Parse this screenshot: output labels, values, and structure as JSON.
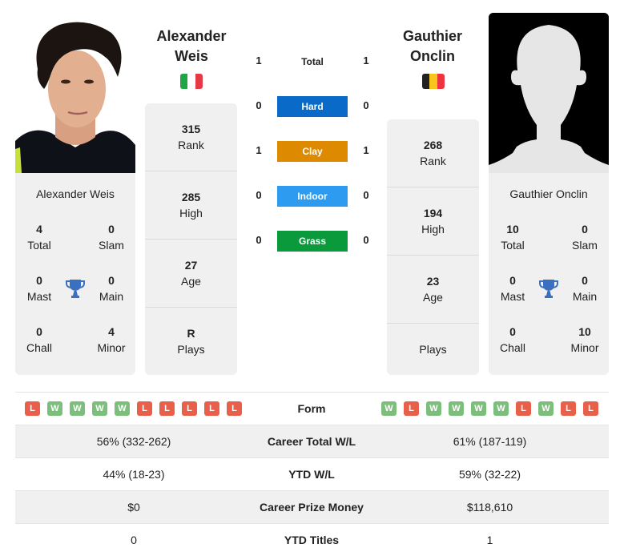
{
  "player1": {
    "name_line1": "Alexander",
    "name_line2": "Weis",
    "full_name": "Alexander Weis",
    "flag": {
      "country": "Italy",
      "colors": [
        "#1fa446",
        "#ffffff",
        "#e63946"
      ]
    },
    "titles": {
      "total": {
        "value": "4",
        "label": "Total"
      },
      "slam": {
        "value": "0",
        "label": "Slam"
      },
      "mast": {
        "value": "0",
        "label": "Mast"
      },
      "main": {
        "value": "0",
        "label": "Main"
      },
      "chall": {
        "value": "0",
        "label": "Chall"
      },
      "minor": {
        "value": "4",
        "label": "Minor"
      }
    },
    "rank": {
      "value": "315",
      "label": "Rank"
    },
    "high": {
      "value": "285",
      "label": "High"
    },
    "age": {
      "value": "27",
      "label": "Age"
    },
    "plays": {
      "value": "R",
      "label": "Plays"
    },
    "form": [
      "L",
      "W",
      "W",
      "W",
      "W",
      "L",
      "L",
      "L",
      "L",
      "L"
    ]
  },
  "player2": {
    "name_line1": "Gauthier",
    "name_line2": "Onclin",
    "full_name": "Gauthier Onclin",
    "flag": {
      "country": "Belgium",
      "colors": [
        "#222222",
        "#f7c51e",
        "#ef3340"
      ]
    },
    "titles": {
      "total": {
        "value": "10",
        "label": "Total"
      },
      "slam": {
        "value": "0",
        "label": "Slam"
      },
      "mast": {
        "value": "0",
        "label": "Mast"
      },
      "main": {
        "value": "0",
        "label": "Main"
      },
      "chall": {
        "value": "0",
        "label": "Chall"
      },
      "minor": {
        "value": "10",
        "label": "Minor"
      }
    },
    "rank": {
      "value": "268",
      "label": "Rank"
    },
    "high": {
      "value": "194",
      "label": "High"
    },
    "age": {
      "value": "23",
      "label": "Age"
    },
    "plays": {
      "value": "",
      "label": "Plays"
    },
    "form": [
      "W",
      "L",
      "W",
      "W",
      "W",
      "W",
      "L",
      "W",
      "L",
      "L"
    ]
  },
  "h2h": {
    "total": {
      "label": "Total",
      "p1": "1",
      "p2": "1"
    },
    "surfaces": [
      {
        "label": "Hard",
        "p1": "0",
        "p2": "0",
        "color": "#0a6ac7"
      },
      {
        "label": "Clay",
        "p1": "1",
        "p2": "1",
        "color": "#de8a00"
      },
      {
        "label": "Indoor",
        "p1": "0",
        "p2": "0",
        "color": "#2d9cf0"
      },
      {
        "label": "Grass",
        "p1": "0",
        "p2": "0",
        "color": "#0a9a3c"
      }
    ]
  },
  "form_label": "Form",
  "stats": [
    {
      "label": "Career Total W/L",
      "p1": "56% (332-262)",
      "p2": "61% (187-119)"
    },
    {
      "label": "YTD W/L",
      "p1": "44% (18-23)",
      "p2": "59% (32-22)"
    },
    {
      "label": "Career Prize Money",
      "p1": "$0",
      "p2": "$118,610"
    },
    {
      "label": "YTD Titles",
      "p1": "0",
      "p2": "1"
    }
  ],
  "colors": {
    "win": "#7cbf7c",
    "loss": "#e9604a",
    "trophy": "#3b6fbf",
    "card_bg": "#f0f0f0"
  }
}
